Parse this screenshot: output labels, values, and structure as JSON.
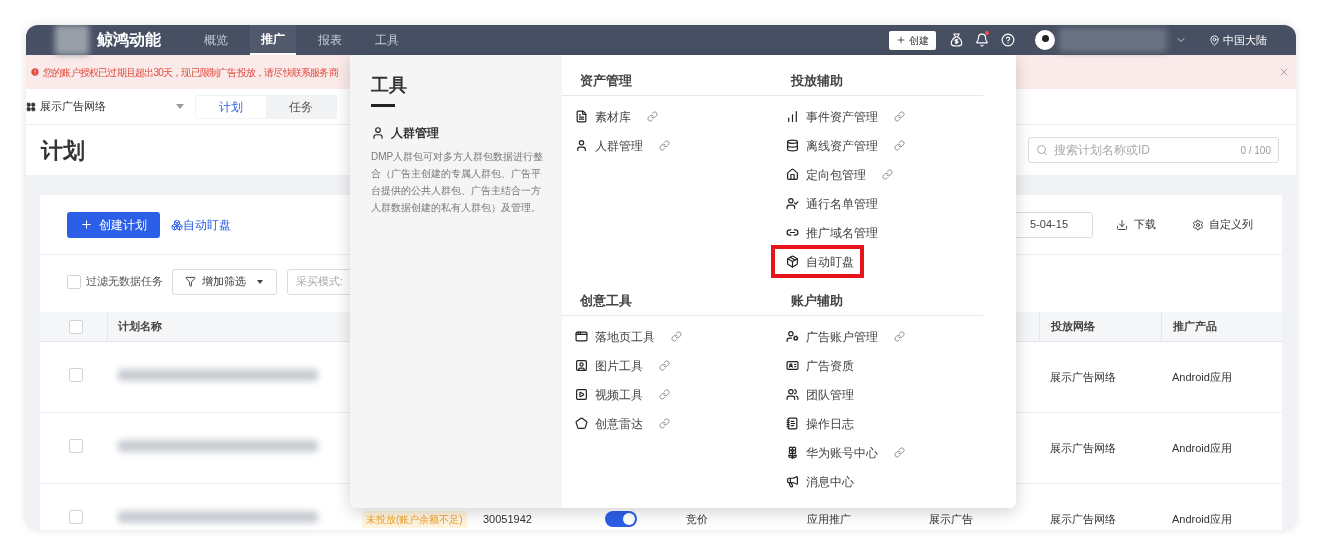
{
  "top_nav": {
    "brand": "鲸鸿动能",
    "items": [
      {
        "label": "概览",
        "selected": false
      },
      {
        "label": "推广",
        "selected": true
      },
      {
        "label": "报表",
        "selected": false
      },
      {
        "label": "工具",
        "selected": false
      }
    ],
    "create_button": "创建",
    "notification_dot": true,
    "region": "中国大陆"
  },
  "alert": {
    "message": "您的账户授权已过期且超出30天，现已限制广告投放，请尽快联系服务商"
  },
  "network_select": {
    "value": "展示广告网络"
  },
  "view_tabs": [
    {
      "label": "计划",
      "selected": true
    },
    {
      "label": "任务",
      "selected": false
    }
  ],
  "page_title": "计划",
  "search": {
    "placeholder": "搜索计划名称或ID",
    "counter": "0 / 100"
  },
  "toolbar": {
    "create_button": "创建计划",
    "auto_watch_link": "自动盯盘",
    "date_value": "5-04-15",
    "download": "下载",
    "custom_columns": "自定义列"
  },
  "filters": {
    "no_data_checkbox": {
      "label": "过滤无数据任务",
      "checked": false
    },
    "add_filter": "增加筛选",
    "purchase_mode_field": "采买模式:"
  },
  "table": {
    "header_checked": false,
    "columns": [
      "计划名称",
      "投放网络",
      "推广产品"
    ],
    "rows": [
      {
        "checked": false,
        "network": "展示广告网络",
        "product": "Android应用"
      },
      {
        "checked": false,
        "network": "展示广告网络",
        "product": "Android应用"
      },
      {
        "checked": false,
        "status": "未投放(账户余额不足)",
        "id": "30051942",
        "on": true,
        "bid_type": "竞价",
        "promotion_type": "应用推广",
        "ad_type": "展示广告",
        "network": "展示广告网络",
        "product": "Android应用"
      }
    ]
  },
  "tools_menu": {
    "title": "工具",
    "feature": {
      "title": "人群管理",
      "description": "DMP人群包可对多方人群包数据进行整合（广告主创建的专属人群包、广告平台提供的公共人群包、广告主结合一方人群数据创建的私有人群包）及管理。"
    },
    "sections": [
      {
        "columns": [
          {
            "heading": "资产管理",
            "items": [
              {
                "label": "素材库",
                "link": true,
                "highlighted": false
              },
              {
                "label": "人群管理",
                "link": true,
                "highlighted": false
              }
            ]
          },
          {
            "heading": "投放辅助",
            "items": [
              {
                "label": "事件资产管理",
                "link": true,
                "highlighted": false
              },
              {
                "label": "离线资产管理",
                "link": true,
                "highlighted": false
              },
              {
                "label": "定向包管理",
                "link": true,
                "highlighted": false
              },
              {
                "label": "通行名单管理",
                "link": false,
                "highlighted": false
              },
              {
                "label": "推广域名管理",
                "link": false,
                "highlighted": false
              },
              {
                "label": "自动盯盘",
                "link": false,
                "highlighted": true
              }
            ]
          }
        ]
      },
      {
        "columns": [
          {
            "heading": "创意工具",
            "items": [
              {
                "label": "落地页工具",
                "link": true,
                "highlighted": false
              },
              {
                "label": "图片工具",
                "link": true,
                "highlighted": false
              },
              {
                "label": "视频工具",
                "link": true,
                "highlighted": false
              },
              {
                "label": "创意雷达",
                "link": true,
                "highlighted": false
              }
            ]
          },
          {
            "heading": "账户辅助",
            "items": [
              {
                "label": "广告账户管理",
                "link": true,
                "highlighted": false
              },
              {
                "label": "广告资质",
                "link": false,
                "highlighted": false
              },
              {
                "label": "团队管理",
                "link": false,
                "highlighted": false
              },
              {
                "label": "操作日志",
                "link": false,
                "highlighted": false
              },
              {
                "label": "华为账号中心",
                "link": true,
                "highlighted": false
              },
              {
                "label": "消息中心",
                "link": false,
                "highlighted": false
              }
            ]
          }
        ]
      }
    ]
  }
}
